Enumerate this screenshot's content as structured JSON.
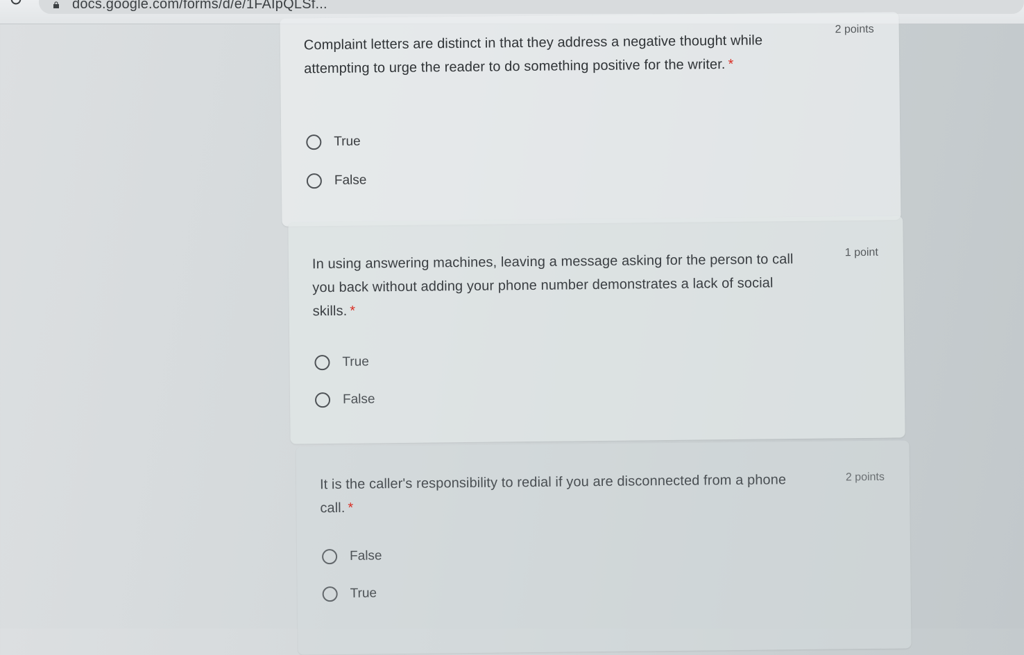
{
  "browser": {
    "url": "docs.google.com/forms/d/e/1FAIpQLSf..."
  },
  "questions": [
    {
      "text": "Complaint letters are distinct in that they address a negative thought while attempting to urge the reader to do something positive for the writer.",
      "required_mark": "*",
      "points": "2 points",
      "options": [
        "True",
        "False"
      ]
    },
    {
      "text": "In using answering machines, leaving a message asking for the person to call you back without adding your phone number demonstrates a lack of social skills.",
      "required_mark": "*",
      "points": "1 point",
      "options": [
        "True",
        "False"
      ]
    },
    {
      "text": "It is the caller's responsibility to redial if you are disconnected from a phone call.",
      "required_mark": "*",
      "points": "2 points",
      "options": [
        "False",
        "True"
      ]
    }
  ]
}
